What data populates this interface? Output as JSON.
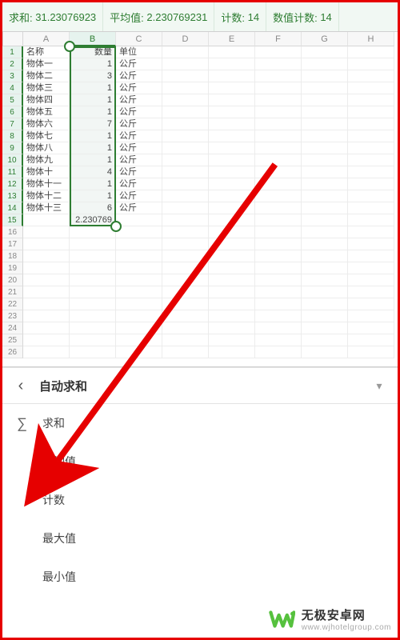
{
  "statusbar": {
    "sum_label": "求和:",
    "sum_value": "31.23076923",
    "avg_label": "平均值:",
    "avg_value": "2.230769231",
    "count_label": "计数:",
    "count_value": "14",
    "numcount_label": "数值计数:",
    "numcount_value": "14"
  },
  "columns": [
    "A",
    "B",
    "C",
    "D",
    "E",
    "F",
    "G",
    "H"
  ],
  "rows_visible": 26,
  "selected_column": "B",
  "selected_rows_from": 1,
  "selected_rows_to": 15,
  "active_cell": "B15",
  "active_cell_value": "2.230769",
  "table": {
    "header": {
      "A": "名称",
      "B": "数量",
      "C": "单位"
    },
    "rows": [
      {
        "A": "物体一",
        "B": "1",
        "C": "公斤"
      },
      {
        "A": "物体二",
        "B": "3",
        "C": "公斤"
      },
      {
        "A": "物体三",
        "B": "1",
        "C": "公斤"
      },
      {
        "A": "物体四",
        "B": "1",
        "C": "公斤"
      },
      {
        "A": "物体五",
        "B": "1",
        "C": "公斤"
      },
      {
        "A": "物体六",
        "B": "7",
        "C": "公斤"
      },
      {
        "A": "物体七",
        "B": "1",
        "C": "公斤"
      },
      {
        "A": "物体八",
        "B": "1",
        "C": "公斤"
      },
      {
        "A": "物体九",
        "B": "1",
        "C": "公斤"
      },
      {
        "A": "物体十",
        "B": "4",
        "C": "公斤"
      },
      {
        "A": "物体十一",
        "B": "1",
        "C": "公斤"
      },
      {
        "A": "物体十二",
        "B": "1",
        "C": "公斤"
      },
      {
        "A": "物体十三",
        "B": "6",
        "C": "公斤"
      }
    ]
  },
  "panel": {
    "back_glyph": "‹",
    "title_label": "自动求和",
    "dropdown_glyph": "▾"
  },
  "menu": {
    "sigma": "∑",
    "items": [
      "求和",
      "平均值",
      "计数",
      "最大值",
      "最小值"
    ]
  },
  "watermark": {
    "line1": "无极安卓网",
    "line2": "www.wjhotelgroup.com"
  }
}
